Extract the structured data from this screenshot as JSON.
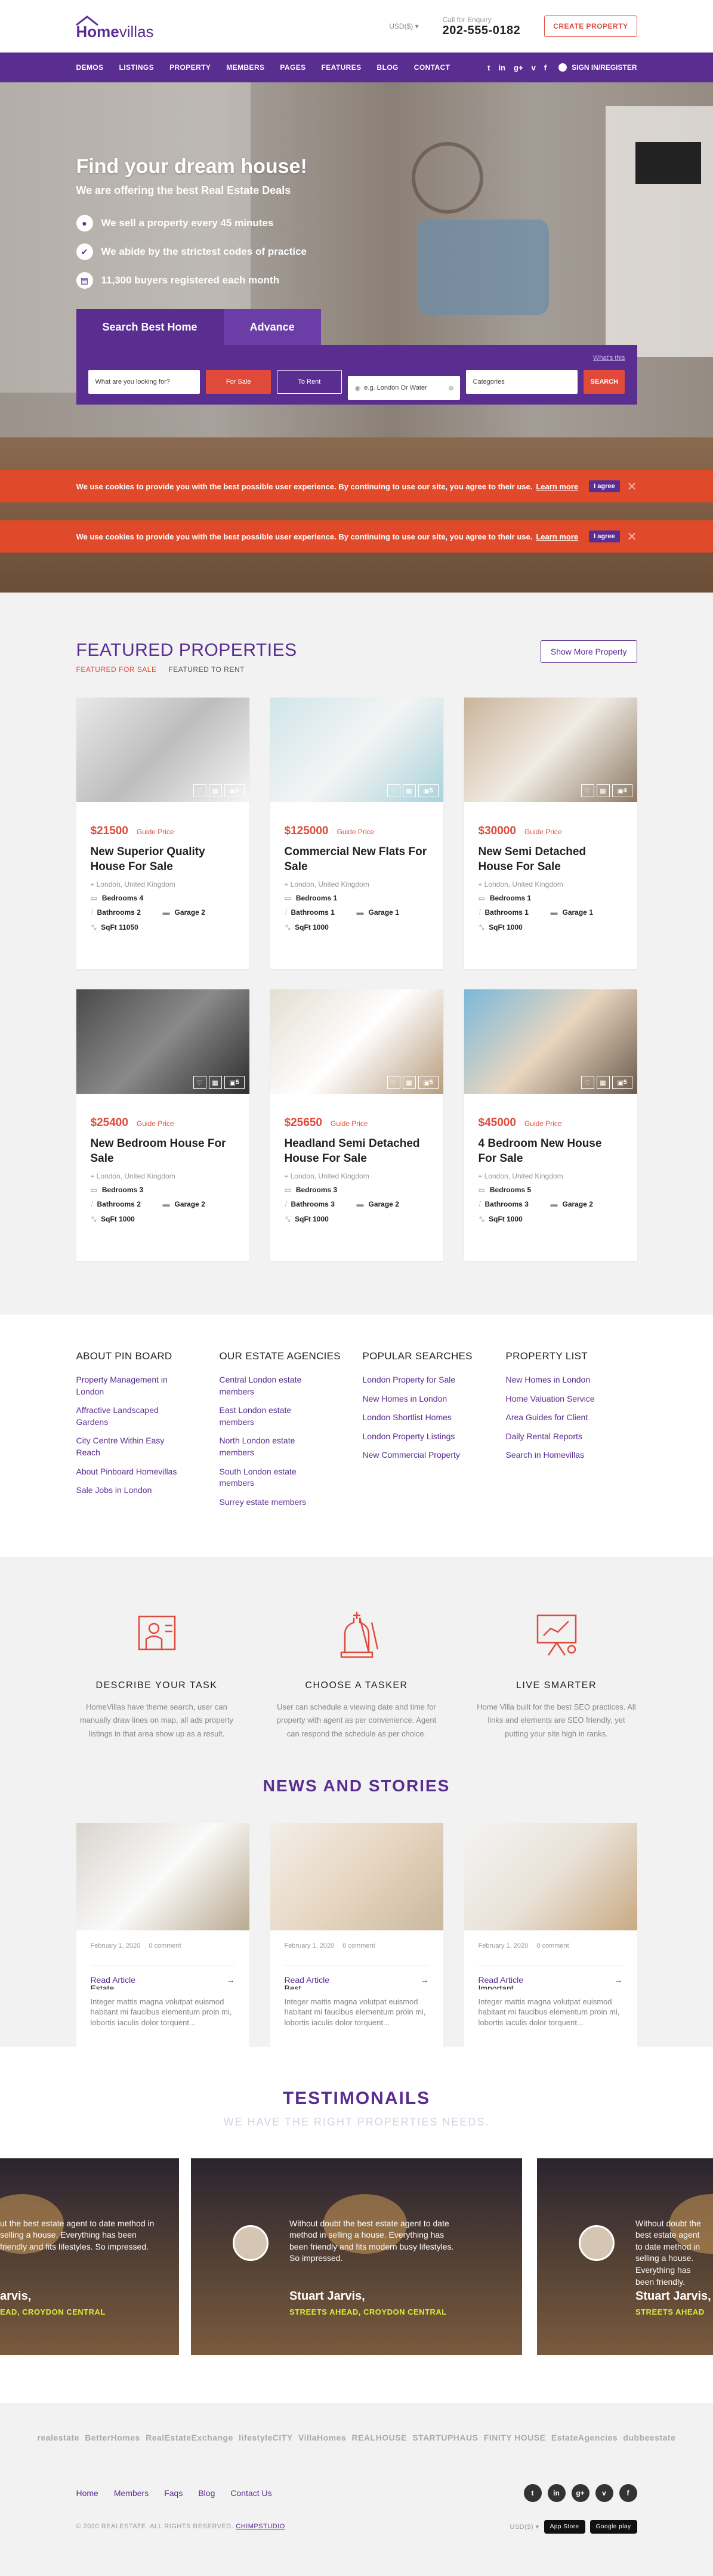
{
  "brand": {
    "home": "Home",
    "villas": "villas"
  },
  "header": {
    "currency": "USD($)",
    "enquiry_label": "Call for Enquiry",
    "phone": "202-555-0182",
    "create_btn": "CREATE PROPERTY"
  },
  "nav": {
    "items": [
      "DEMOS",
      "LISTINGS",
      "PROPERTY",
      "MEMBERS",
      "PAGES",
      "FEATURES",
      "BLOG",
      "CONTACT"
    ],
    "social": [
      "t",
      "in",
      "g+",
      "v",
      "f"
    ],
    "signin": "SIGN IN/REGISTER"
  },
  "hero": {
    "title": "Find your dream house!",
    "subtitle": "We are offering the best Real Estate Deals",
    "bullets": [
      "We sell a property every 45 minutes",
      "We abide by the strictest codes of practice",
      "11,300 buyers registered each month"
    ],
    "tabs": [
      "Search Best Home",
      "Advance"
    ],
    "tips": "What's this",
    "search_placeholder": "What are you looking for?",
    "for_sale": "For Sale",
    "to_rent": "To Rent",
    "location_placeholder": "e.g. London Or Water",
    "categories": "Categories",
    "search_btn": "SEARCH"
  },
  "cookie": {
    "text": "We use cookies to provide you with the best possible user experience. By continuing to use our site, you agree to their use.",
    "learn": "Learn more",
    "agree": "I agree",
    "close": "✕"
  },
  "featured": {
    "title": "FEATURED PROPERTIES",
    "tab_sale": "FEATURED FOR SALE",
    "tab_rent": "FEATURED TO RENT",
    "more": "Show More Property",
    "cards": [
      {
        "price": "$21500",
        "guide": "Guide Price",
        "title": "New Superior Quality House For Sale",
        "loc": "London, United Kingdom",
        "f": [
          "Bedrooms 4",
          "Bathrooms 2",
          "Garage 2",
          "SqFt 11050"
        ],
        "count": "5"
      },
      {
        "price": "$125000",
        "guide": "Guide Price",
        "title": "Commercial New Flats For Sale",
        "loc": "London, United Kingdom",
        "f": [
          "Bedrooms 1",
          "Bathrooms 1",
          "Garage 1",
          "SqFt 1000"
        ],
        "count": "5"
      },
      {
        "price": "$30000",
        "guide": "Guide Price",
        "title": "New Semi Detached House For Sale",
        "loc": "London, United Kingdom",
        "f": [
          "Bedrooms 1",
          "Bathrooms 1",
          "Garage 1",
          "SqFt 1000"
        ],
        "count": "4"
      },
      {
        "price": "$25400",
        "guide": "Guide Price",
        "title": "New Bedroom House For Sale",
        "loc": "London, United Kingdom",
        "f": [
          "Bedrooms 3",
          "Bathrooms 2",
          "Garage 2",
          "SqFt 1000"
        ],
        "count": "5"
      },
      {
        "price": "$25650",
        "guide": "Guide Price",
        "title": "Headland Semi Detached House For Sale",
        "loc": "London, United Kingdom",
        "f": [
          "Bedrooms 3",
          "Bathrooms 3",
          "Garage 2",
          "SqFt 1000"
        ],
        "count": "5"
      },
      {
        "price": "$45000",
        "guide": "Guide Price",
        "title": "4 Bedroom New House For Sale",
        "loc": "London, United Kingdom",
        "f": [
          "Bedrooms 5",
          "Bathrooms 3",
          "Garage 2",
          "SqFt 1000"
        ],
        "count": "5"
      }
    ]
  },
  "footer_links": [
    {
      "h": "ABOUT PIN BOARD",
      "l": [
        "Property Management in London",
        "Affractive Landscaped Gardens",
        "City Centre Within Easy Reach",
        "About Pinboard Homevillas",
        "Sale Jobs in London"
      ]
    },
    {
      "h": "OUR ESTATE AGENCIES",
      "l": [
        "Central London estate members",
        "East London estate members",
        "North London estate members",
        "South London estate members",
        "Surrey estate members"
      ]
    },
    {
      "h": "POPULAR SEARCHES",
      "l": [
        "London Property for Sale",
        "New Homes in London",
        "London Shortlist Homes",
        "London Property Listings",
        "New Commercial Property"
      ]
    },
    {
      "h": "PROPERTY LIST",
      "l": [
        "New Homes in London",
        "Home Valuation Service",
        "Area Guides for Client",
        "Daily Rental Reports",
        "Search in Homevillas"
      ]
    }
  ],
  "how": [
    {
      "h": "DESCRIBE YOUR TASK",
      "p": "HomeVillas have theme search, user can manually draw lines on map, all ads property listings in that area show up as a result."
    },
    {
      "h": "CHOOSE A TASKER",
      "p": "User can schedule a viewing date and time for property with agent as per convenience. Agent can respond the schedule as per choice."
    },
    {
      "h": "LIVE SMARTER",
      "p": "Home Villa built for the best SEO practices. All links and elements are SEO friendly, yet putting your site high in ranks."
    }
  ],
  "news": {
    "title": "NEWS AND STORIES",
    "items": [
      {
        "date": "February 1, 2020",
        "comments": "0 comment",
        "read": "Read Article",
        "head": "Estate ...",
        "excerpt": "Integer mattis magna volutpat euismod habitant mi faucibus elementum proin mi, lobortis iaculis dolor torquent..."
      },
      {
        "date": "February 1, 2020",
        "comments": "0 comment",
        "read": "Read Article",
        "head": "Best ...",
        "excerpt": "Integer mattis magna volutpat euismod habitant mi faucibus elementum proin mi, lobortis iaculis dolor torquent..."
      },
      {
        "date": "February 1, 2020",
        "comments": "0 comment",
        "read": "Read Article",
        "head": "Important ...",
        "excerpt": "Integer mattis magna volutpat euismod habitant mi faucibus elementum proin mi, lobortis iaculis dolor torquent..."
      }
    ]
  },
  "testimonials": {
    "title": "TESTIMONAILS",
    "subtitle": "WE HAVE THE RIGHT PROPERTIES NEEDS.",
    "quote": "Without doubt the best estate agent to date method in selling a house. Everything has been friendly and fits modern busy lifestyles. So impressed.",
    "name": "Stuart Jarvis,",
    "company": "STREETS AHEAD, CROYDON CENTRAL",
    "left_quote": "ut the best estate agent to date method in selling a house. Everything has been friendly and fits lifestyles. So impressed.",
    "left_name": "arvis,",
    "left_company": "EAD, CROYDON CENTRAL",
    "right_quote": "Without doubt the best estate agent to date method in selling a house. Everything has been friendly.",
    "right_name": "Stuart Jarvis,",
    "right_company": "STREETS AHEAD"
  },
  "partners": [
    "realestate",
    "BetterHomes",
    "RealEstateExchange",
    "lifestyleCITY",
    "VillaHomes",
    "REALHOUSE",
    "STARTUPHAUS",
    "FINITY HOUSE",
    "EstateAgencies",
    "dubbeestate"
  ],
  "bottom": {
    "links": [
      "Home",
      "Members",
      "Faqs",
      "Blog",
      "Contact Us"
    ],
    "social": [
      "t",
      "in",
      "g+",
      "v",
      "f"
    ],
    "copy": "© 2020 REALESTATE. ALL RIGHTS RESERVED.",
    "chimp": "CHIMPSTUDIO",
    "currency": "USD($)",
    "appstore": "App Store",
    "gplay": "Google play"
  }
}
